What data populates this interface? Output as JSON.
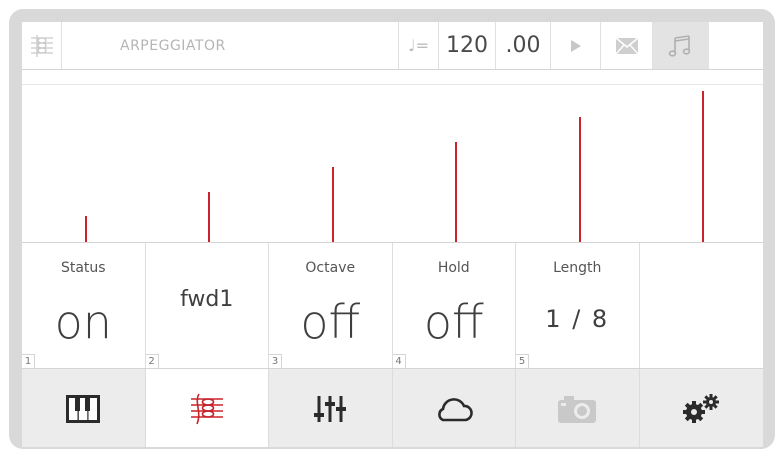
{
  "header": {
    "title": "ARPEGGIATOR",
    "note_symbol": "♩=",
    "tempo_int": "120",
    "tempo_frac": ".00",
    "icons": [
      "arpeggiator-logo-icon",
      "note-tempo-icon",
      "play-icon",
      "mail-icon",
      "music-notes-icon"
    ]
  },
  "bars": {
    "count": 6,
    "levels": [
      0.17,
      0.32,
      0.48,
      0.64,
      0.8,
      0.96
    ],
    "color": "#c8242b"
  },
  "params": [
    {
      "label": "Status",
      "value": "on",
      "num": "1"
    },
    {
      "label": "",
      "value": "fwd1",
      "num": "2"
    },
    {
      "label": "Octave",
      "value": "off",
      "num": "3"
    },
    {
      "label": "Hold",
      "value": "off",
      "num": "4"
    },
    {
      "label": "Length",
      "value": "1 / 8",
      "num": "5"
    },
    {
      "label": "",
      "value": "",
      "num": ""
    }
  ],
  "tabs": [
    {
      "name": "piano-keys-icon",
      "active": false
    },
    {
      "name": "arpeggiator-icon",
      "active": true
    },
    {
      "name": "sliders-icon",
      "active": false
    },
    {
      "name": "cloud-icon",
      "active": false
    },
    {
      "name": "camera-icon",
      "active": false
    },
    {
      "name": "gears-icon",
      "active": false
    }
  ],
  "colors": {
    "accent": "#c8242b",
    "frame": "#d9d9d9"
  }
}
